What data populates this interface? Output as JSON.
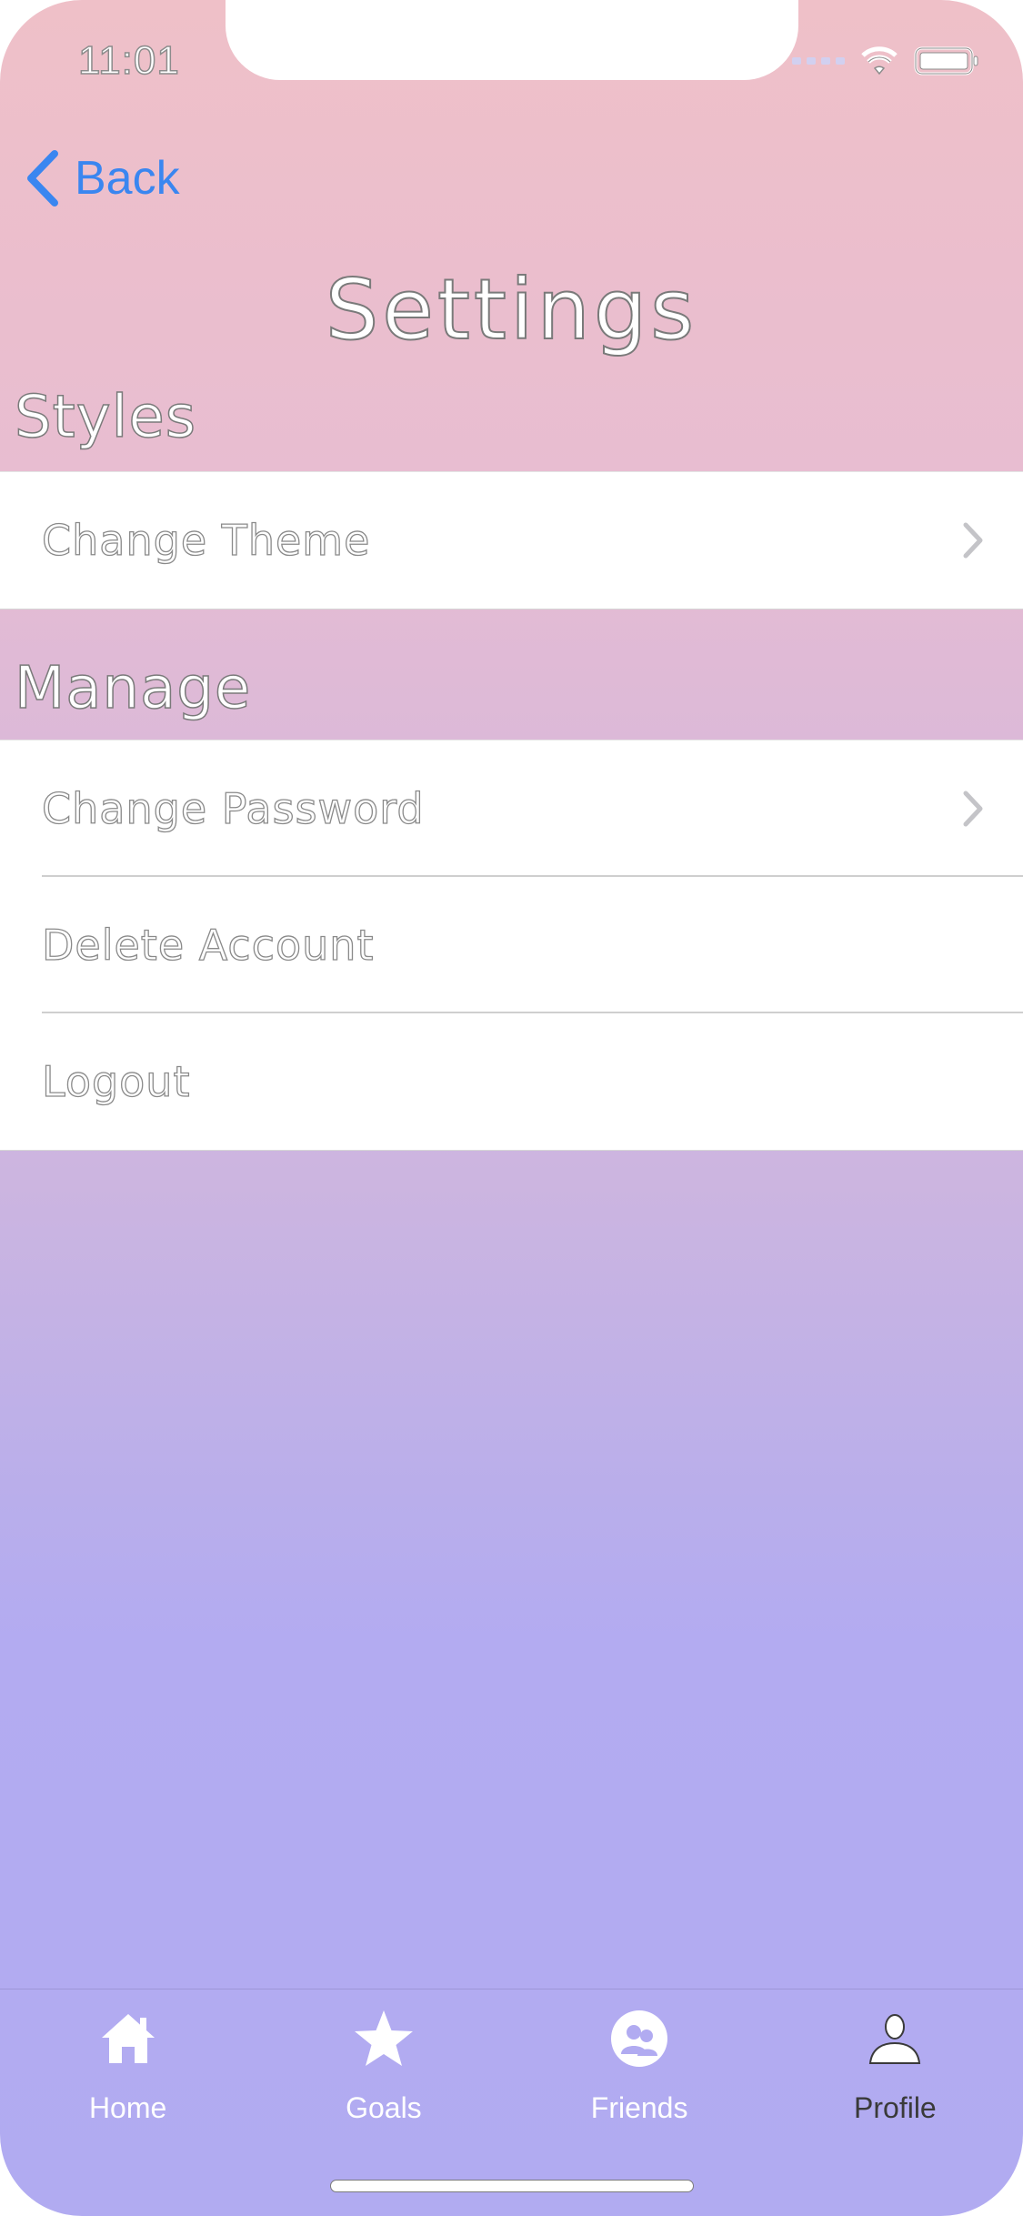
{
  "status_bar": {
    "time": "11:01",
    "icons": [
      "signal-icon",
      "wifi-icon",
      "battery-icon"
    ]
  },
  "nav": {
    "back_label": "Back",
    "title": "Settings"
  },
  "sections": {
    "styles": {
      "header": "Styles",
      "items": [
        {
          "label": "Change Theme",
          "icon": "chevron-right-icon"
        }
      ]
    },
    "manage": {
      "header": "Manage",
      "items": [
        {
          "label": "Change Password",
          "icon": "chevron-right-icon"
        },
        {
          "label": "Delete Account"
        },
        {
          "label": "Logout"
        }
      ]
    }
  },
  "tab_bar": {
    "tabs": [
      {
        "label": "Home",
        "icon": "home-icon",
        "active": false
      },
      {
        "label": "Goals",
        "icon": "star-icon",
        "active": false
      },
      {
        "label": "Friends",
        "icon": "friends-icon",
        "active": false
      },
      {
        "label": "Profile",
        "icon": "profile-icon",
        "active": true
      }
    ]
  },
  "colors": {
    "accent": "#3a86f0",
    "gradient_top": "#efc0c8",
    "gradient_bottom": "#b1abf1",
    "row_background": "#ffffff"
  }
}
